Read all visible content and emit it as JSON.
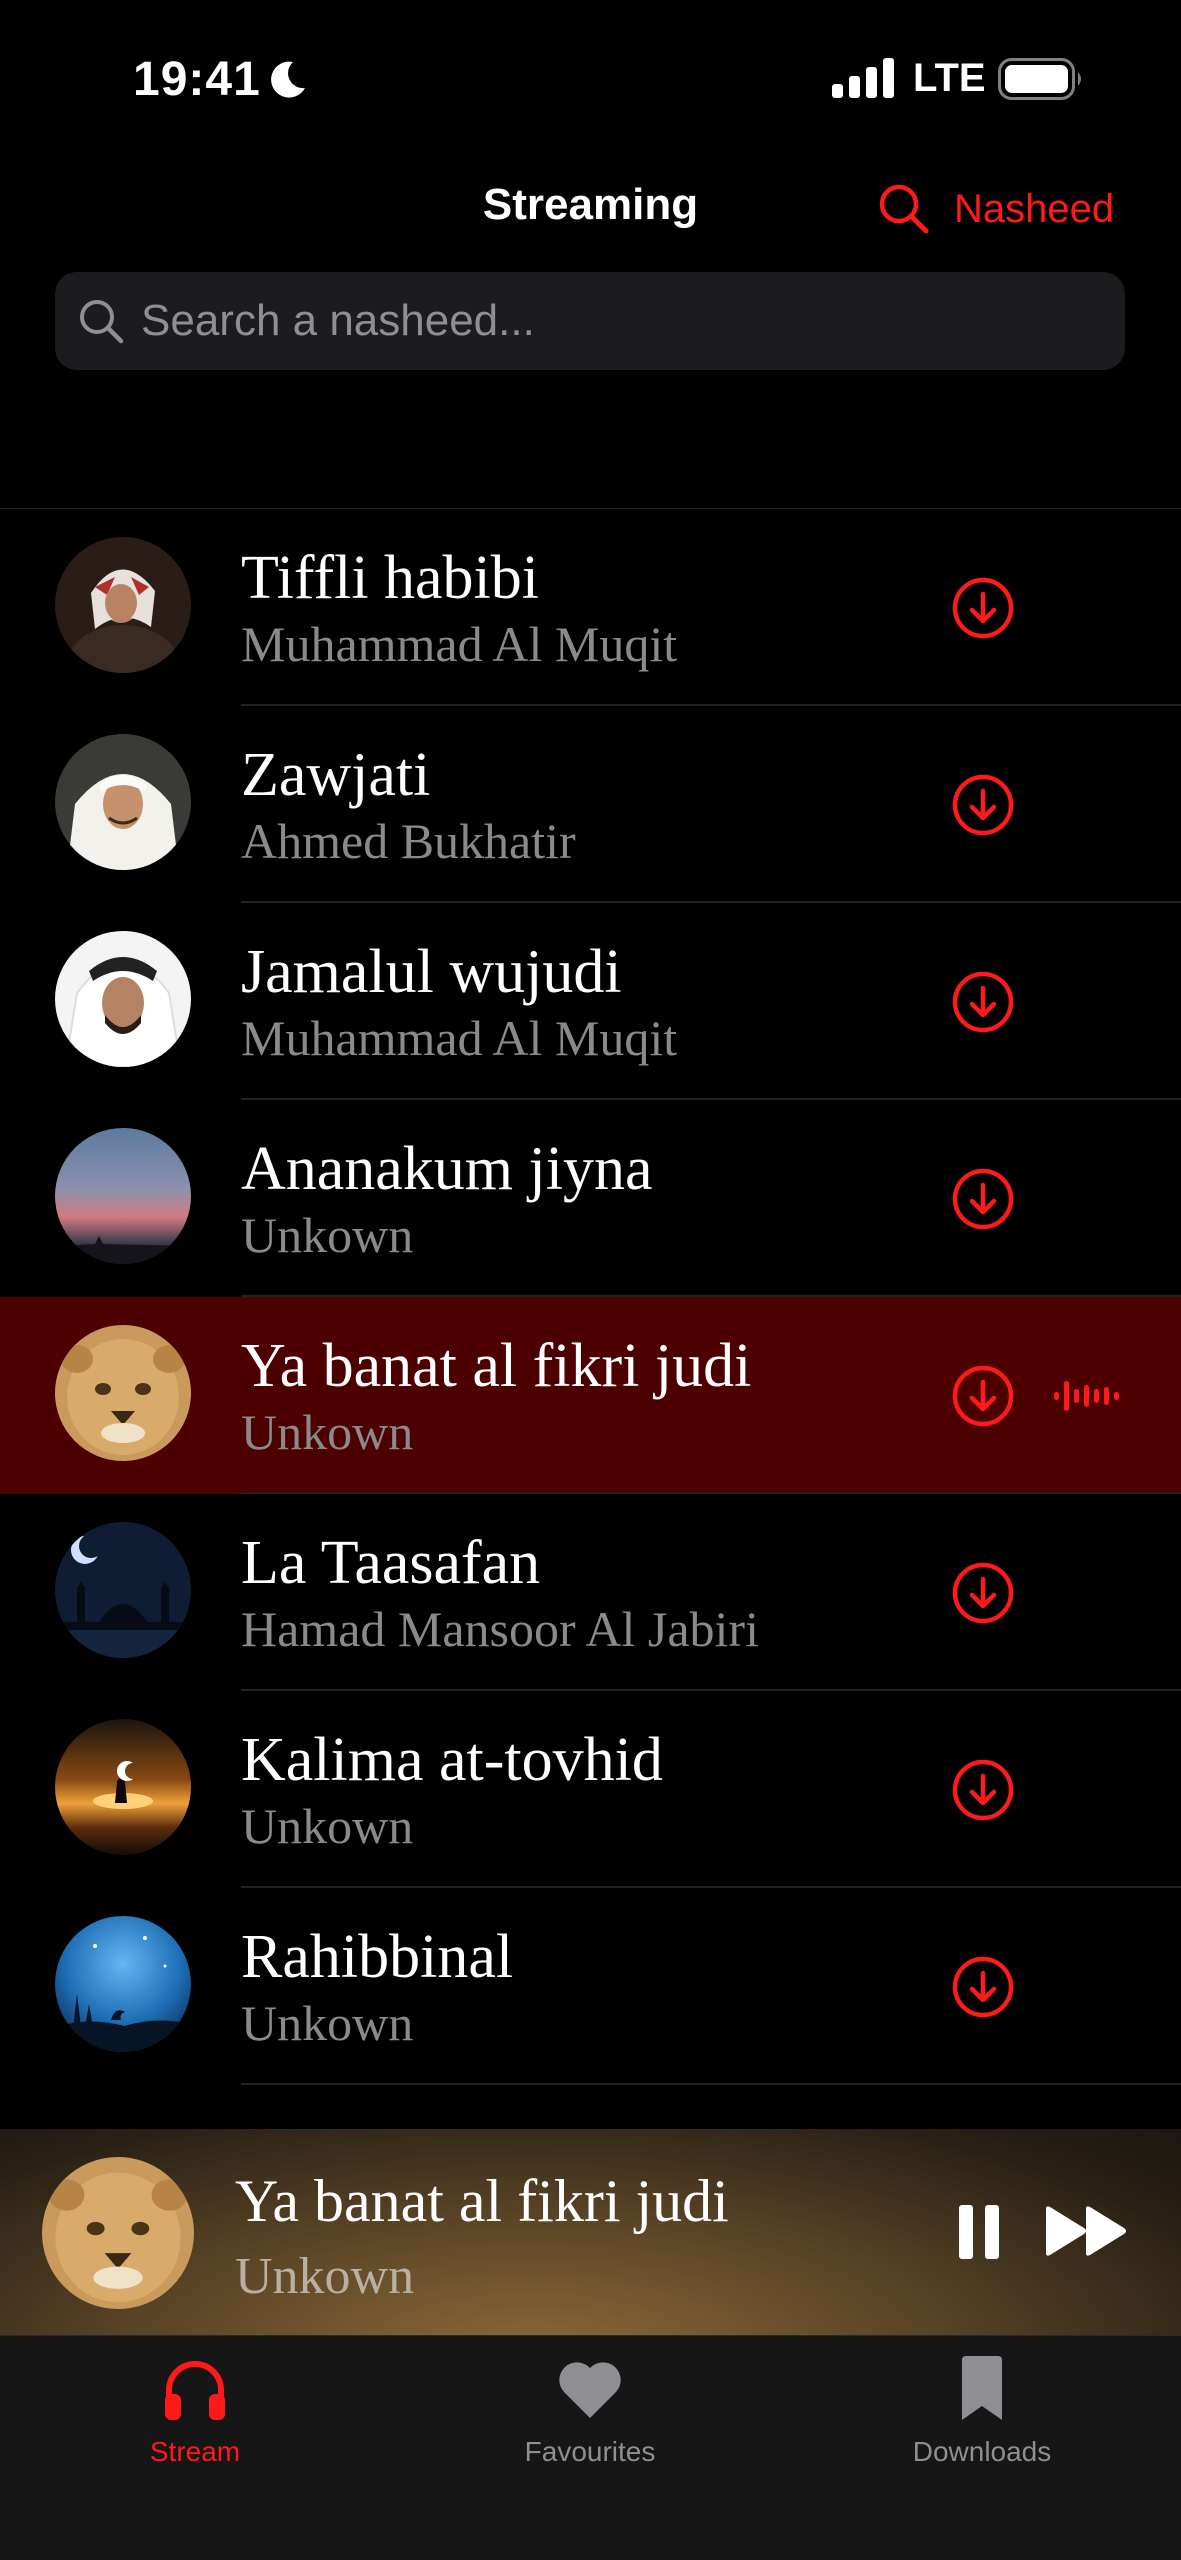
{
  "status_bar": {
    "time": "19:41",
    "network": "LTE"
  },
  "header": {
    "title": "Streaming",
    "action_label": "Nasheed"
  },
  "search": {
    "placeholder": "Search a nasheed..."
  },
  "colors": {
    "accent": "#ff1a1a",
    "active_row": "#4d0000",
    "background": "#000000"
  },
  "tracks": [
    {
      "title": "Tiffli habibi",
      "artist": "Muhammad Al Muqit"
    },
    {
      "title": "Zawjati",
      "artist": "Ahmed Bukhatir"
    },
    {
      "title": "Jamalul wujudi",
      "artist": "Muhammad Al Muqit"
    },
    {
      "title": "Ananakum jiyna",
      "artist": "Unkown"
    },
    {
      "title": "Ya banat al fikri judi",
      "artist": "Unkown",
      "playing": true
    },
    {
      "title": "La Taasafan",
      "artist": "Hamad Mansoor Al Jabiri"
    },
    {
      "title": "Kalima at-tovhid",
      "artist": "Unkown"
    },
    {
      "title": "Rahibbinal",
      "artist": "Unkown"
    }
  ],
  "now_playing": {
    "title": "Ya banat al fikri judi",
    "artist": "Unkown"
  },
  "tabs": [
    {
      "label": "Stream",
      "icon": "headphones-icon",
      "active": true
    },
    {
      "label": "Favourites",
      "icon": "heart-icon",
      "active": false
    },
    {
      "label": "Downloads",
      "icon": "bookmark-icon",
      "active": false
    }
  ]
}
